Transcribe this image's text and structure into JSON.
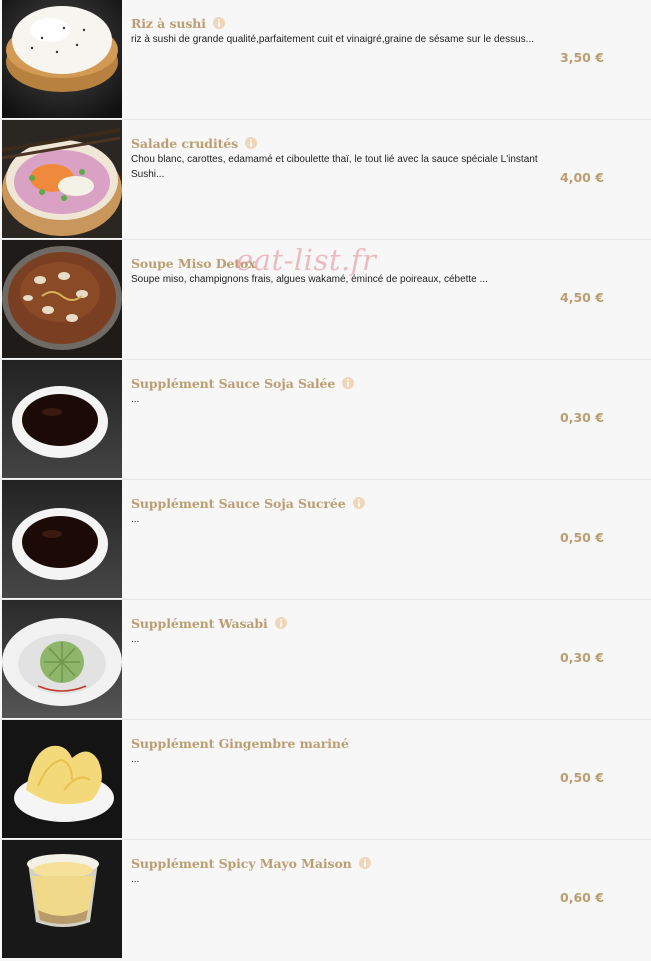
{
  "watermark": "eat-list.fr",
  "colors": {
    "title": "#bc9e72",
    "price": "#bc9e72",
    "info_icon": "#f0d5b8",
    "row_background": "#f7f7f7"
  },
  "items": [
    {
      "name": "Riz à sushi",
      "description": "riz à sushi de grande qualité,parfaitement cuit et vinaigré,graine de sésame sur le dessus...",
      "price": "3,50 €"
    },
    {
      "name": "Salade crudités",
      "description": "Chou blanc, carottes, edamamé et ciboulette thaï, le tout lié avec la sauce spéciale L'instant Sushi...",
      "price": "4,00 €"
    },
    {
      "name": "Soupe Miso Detox",
      "description": "Soupe miso, champignons frais, algues wakamé, émincé de poireaux, cébette ...",
      "price": "4,50 €"
    },
    {
      "name": "Supplément Sauce Soja Salée",
      "description": "...",
      "price": "0,30 €"
    },
    {
      "name": "Supplément Sauce Soja Sucrée",
      "description": "...",
      "price": "0,50 €"
    },
    {
      "name": "Supplément Wasabi",
      "description": "...",
      "price": "0,30 €"
    },
    {
      "name": "Supplément Gingembre mariné",
      "description": "...",
      "price": "0,50 €"
    },
    {
      "name": "Supplément Spicy Mayo Maison",
      "description": "...",
      "price": "0,60 €"
    }
  ]
}
